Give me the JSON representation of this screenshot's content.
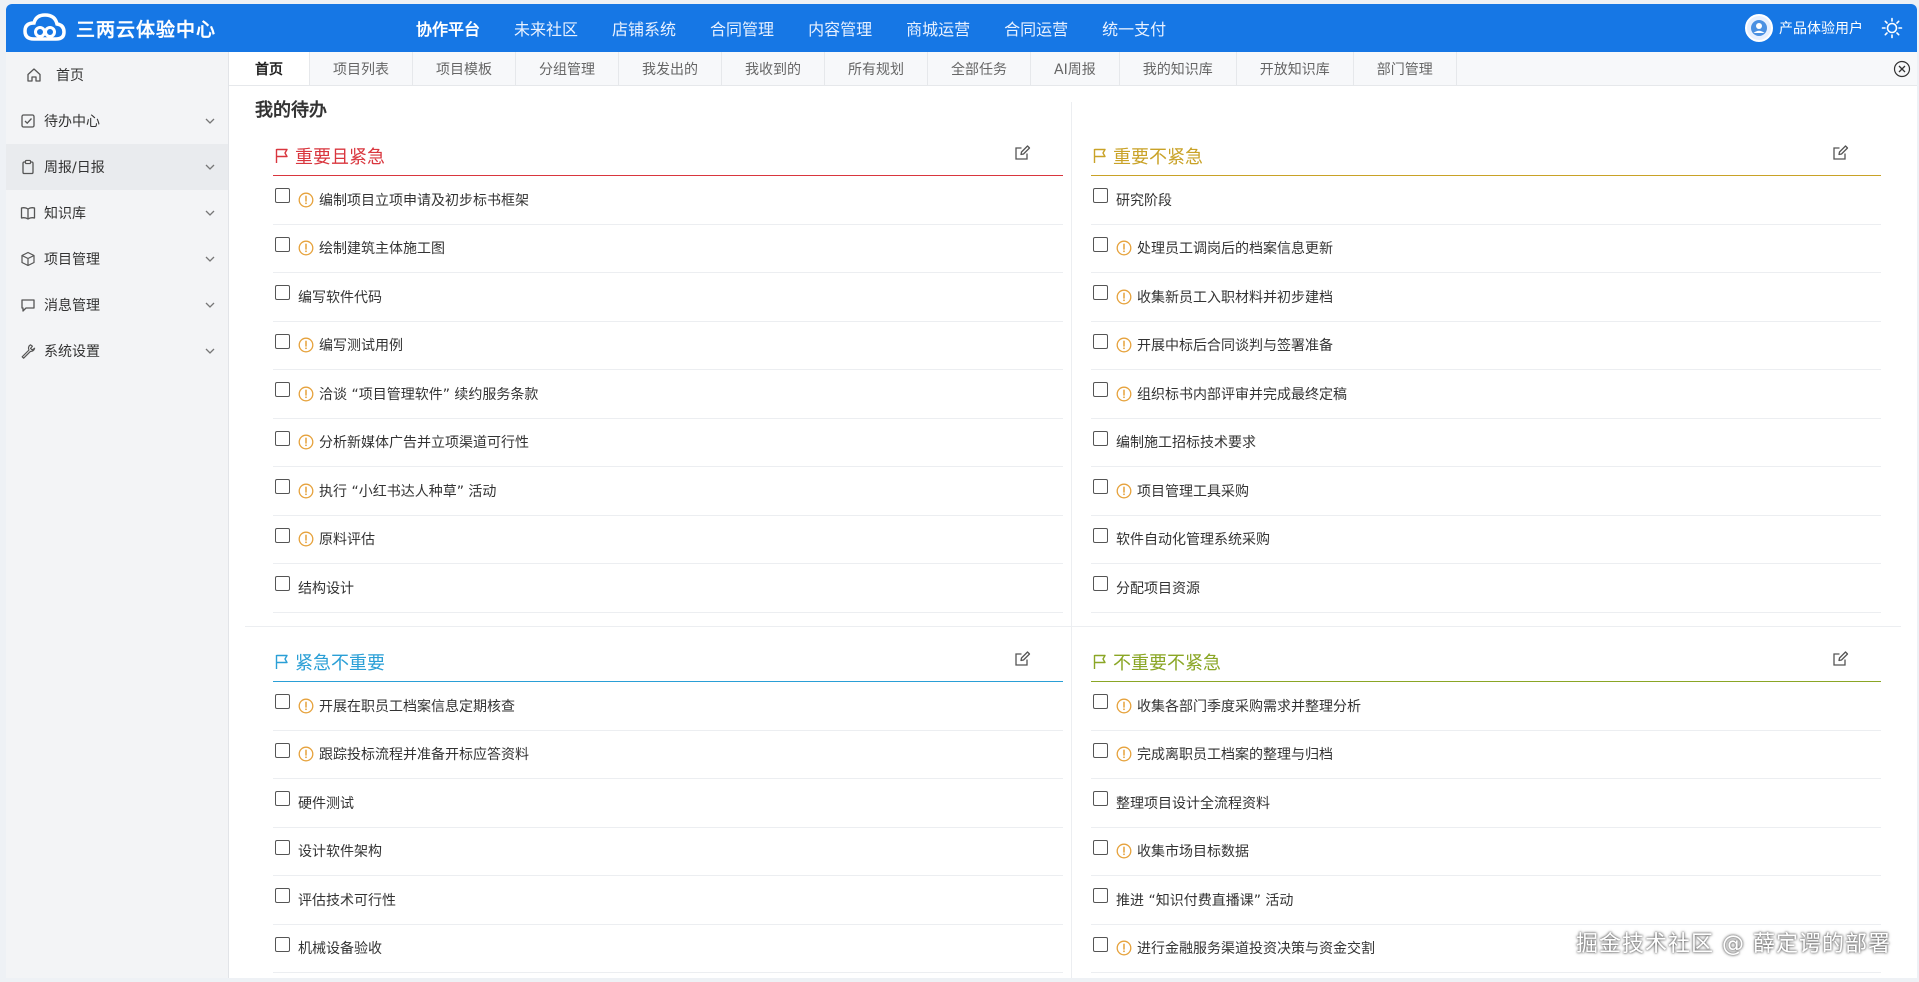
{
  "app": {
    "name": "三两云体验中心"
  },
  "topnav": [
    {
      "label": "协作平台",
      "active": true
    },
    {
      "label": "未来社区"
    },
    {
      "label": "店铺系统"
    },
    {
      "label": "合同管理"
    },
    {
      "label": "内容管理"
    },
    {
      "label": "商城运营"
    },
    {
      "label": "合同运营"
    },
    {
      "label": "统一支付"
    }
  ],
  "user": {
    "name": "产品体验用户"
  },
  "sidebar": {
    "items": [
      {
        "label": "首页",
        "icon": "home-icon"
      },
      {
        "label": "待办中心",
        "icon": "checkbox-icon"
      },
      {
        "label": "周报/日报",
        "icon": "clipboard-icon",
        "active": true
      },
      {
        "label": "知识库",
        "icon": "book-icon"
      },
      {
        "label": "项目管理",
        "icon": "cube-icon"
      },
      {
        "label": "消息管理",
        "icon": "message-icon"
      },
      {
        "label": "系统设置",
        "icon": "wrench-icon"
      }
    ]
  },
  "tabs": [
    "首页",
    "项目列表",
    "项目模板",
    "分组管理",
    "我发出的",
    "我收到的",
    "所有规划",
    "全部任务",
    "AI周报",
    "我的知识库",
    "开放知识库",
    "部门管理"
  ],
  "page": {
    "title": "我的待办"
  },
  "quadrants": {
    "q1": {
      "title": "重要且紧急",
      "color": "#d9363e",
      "items": [
        {
          "text": "编制项目立项申请及初步标书框架",
          "warn": true
        },
        {
          "text": "绘制建筑主体施工图",
          "warn": true
        },
        {
          "text": "编写软件代码",
          "warn": false
        },
        {
          "text": "编写测试用例",
          "warn": true
        },
        {
          "text": "洽谈 “项目管理软件” 续约服务条款",
          "warn": true
        },
        {
          "text": "分析新媒体广告并立项渠道可行性",
          "warn": true
        },
        {
          "text": "执行 “小红书达人种草” 活动",
          "warn": true
        },
        {
          "text": "原料评估",
          "warn": true
        },
        {
          "text": "结构设计",
          "warn": false
        }
      ]
    },
    "q2": {
      "title": "重要不紧急",
      "color": "#c9a227",
      "items": [
        {
          "text": "研究阶段",
          "warn": false
        },
        {
          "text": "处理员工调岗后的档案信息更新",
          "warn": true
        },
        {
          "text": "收集新员工入职材料并初步建档",
          "warn": true
        },
        {
          "text": "开展中标后合同谈判与签署准备",
          "warn": true
        },
        {
          "text": "组织标书内部评审并完成最终定稿",
          "warn": true
        },
        {
          "text": "编制施工招标技术要求",
          "warn": false
        },
        {
          "text": "项目管理工具采购",
          "warn": true
        },
        {
          "text": "软件自动化管理系统采购",
          "warn": false
        },
        {
          "text": "分配项目资源",
          "warn": false
        }
      ]
    },
    "q3": {
      "title": "紧急不重要",
      "color": "#2a9fd6",
      "items": [
        {
          "text": "开展在职员工档案信息定期核查",
          "warn": true
        },
        {
          "text": "跟踪投标流程并准备开标应答资料",
          "warn": true
        },
        {
          "text": "硬件测试",
          "warn": false
        },
        {
          "text": "设计软件架构",
          "warn": false
        },
        {
          "text": "评估技术可行性",
          "warn": false
        },
        {
          "text": "机械设备验收",
          "warn": false
        }
      ]
    },
    "q4": {
      "title": "不重要不紧急",
      "color": "#8aa625",
      "items": [
        {
          "text": "收集各部门季度采购需求并整理分析",
          "warn": true
        },
        {
          "text": "完成离职员工档案的整理与归档",
          "warn": true
        },
        {
          "text": "整理项目设计全流程资料",
          "warn": false
        },
        {
          "text": "收集市场目标数据",
          "warn": true
        },
        {
          "text": "推进 “知识付费直播课” 活动",
          "warn": false
        },
        {
          "text": "进行金融服务渠道投资决策与资金交割",
          "warn": true
        }
      ]
    }
  },
  "watermark": "掘金技术社区 @ 薛定谔的部署",
  "colors": {
    "brand": "#1677e5",
    "warn": "#e6a23c"
  }
}
